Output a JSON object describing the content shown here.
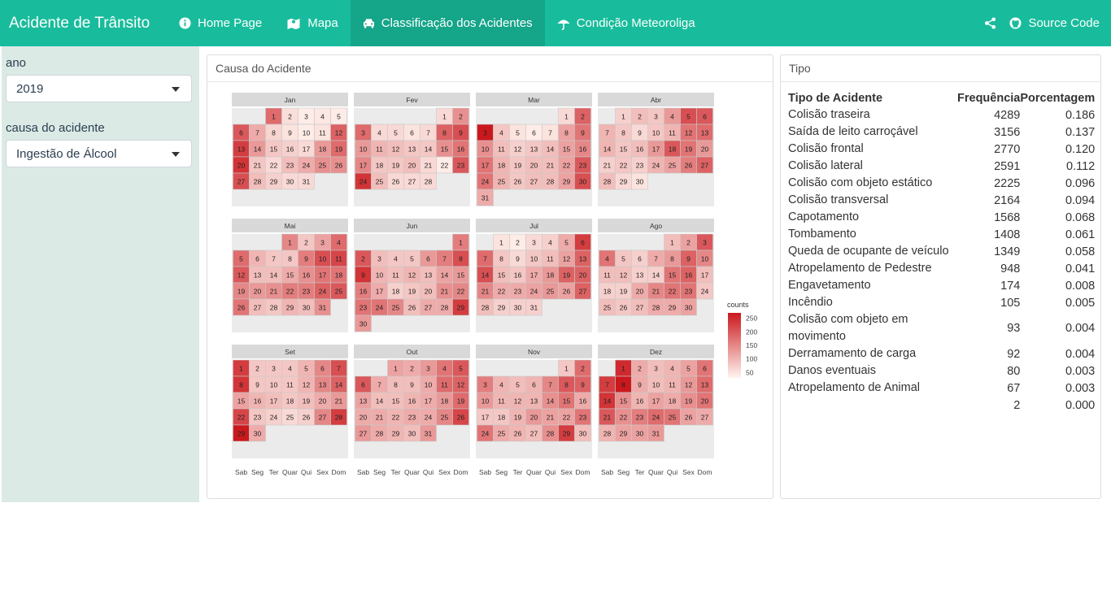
{
  "app": {
    "brand": "Acidente de Trânsito"
  },
  "nav": {
    "items": [
      {
        "label": "Home Page",
        "icon": "info-circle-icon",
        "active": false
      },
      {
        "label": "Mapa",
        "icon": "map-icon",
        "active": false
      },
      {
        "label": "Classificação dos Acidentes",
        "icon": "car-icon",
        "active": true
      },
      {
        "label": "Condição Meteoroliga",
        "icon": "umbrella-icon",
        "active": false
      }
    ],
    "share_icon": "share-icon",
    "source": {
      "label": "Source Code",
      "icon": "github-icon"
    }
  },
  "sidebar": {
    "ano_label": "ano",
    "ano_value": "2019",
    "causa_label": "causa do acidente",
    "causa_value": "Ingestão de Álcool"
  },
  "calendar_panel": {
    "title": "Causa do Acidente"
  },
  "tipo_panel": {
    "title": "Tipo",
    "headers": [
      "Tipo de Acidente",
      "Frequência",
      "Porcentagem"
    ],
    "rows": [
      [
        "Colisão traseira",
        "4289",
        "0.186"
      ],
      [
        "Saída de leito carroçável",
        "3156",
        "0.137"
      ],
      [
        "Colisão frontal",
        "2770",
        "0.120"
      ],
      [
        "Colisão lateral",
        "2591",
        "0.112"
      ],
      [
        "Colisão com objeto estático",
        "2225",
        "0.096"
      ],
      [
        "Colisão transversal",
        "2164",
        "0.094"
      ],
      [
        "Capotamento",
        "1568",
        "0.068"
      ],
      [
        "Tombamento",
        "1408",
        "0.061"
      ],
      [
        "Queda de ocupante de veículo",
        "1349",
        "0.058"
      ],
      [
        "Atropelamento de Pedestre",
        "948",
        "0.041"
      ],
      [
        "Engavetamento",
        "174",
        "0.008"
      ],
      [
        "Incêndio",
        "105",
        "0.005"
      ],
      [
        "Colisão com objeto em movimento",
        "93",
        "0.004"
      ],
      [
        "Derramamento de carga",
        "92",
        "0.004"
      ],
      [
        "Danos eventuais",
        "80",
        "0.003"
      ],
      [
        "Atropelamento de Animal",
        "67",
        "0.003"
      ],
      [
        "",
        "2",
        "0.000"
      ]
    ]
  },
  "colors": {
    "navbar": "#18bc9c",
    "navbar_active": "#15a589",
    "sidebar": "#dbeae5",
    "heat_high": "#cb181d",
    "heat_low": "#fff5f0"
  },
  "chart_data": {
    "type": "heatmap",
    "year": 2019,
    "weekdays": [
      "Sab",
      "Seg",
      "Ter",
      "Quar",
      "Qui",
      "Sex",
      "Dom"
    ],
    "legend": {
      "title": "counts",
      "ticks": [
        250,
        200,
        150,
        100,
        50
      ]
    },
    "months": [
      {
        "name": "Jan",
        "first_col": 2,
        "counts": [
          180,
          55,
          40,
          45,
          40,
          200,
          110,
          65,
          50,
          40,
          50,
          190,
          230,
          130,
          80,
          70,
          60,
          130,
          180,
          240,
          80,
          60,
          90,
          110,
          140,
          140,
          210,
          90,
          70,
          60,
          60
        ]
      },
      {
        "name": "Fev",
        "first_col": 5,
        "counts": [
          60,
          140,
          180,
          60,
          60,
          50,
          60,
          190,
          210,
          130,
          100,
          90,
          80,
          80,
          140,
          170,
          150,
          80,
          80,
          90,
          60,
          40,
          200,
          240,
          90,
          60,
          60,
          60
        ]
      },
      {
        "name": "Mar",
        "first_col": 5,
        "counts": [
          60,
          190,
          270,
          80,
          50,
          40,
          50,
          120,
          170,
          140,
          90,
          70,
          80,
          90,
          120,
          150,
          170,
          100,
          80,
          90,
          90,
          120,
          200,
          170,
          100,
          80,
          90,
          90,
          120,
          210,
          110
        ]
      },
      {
        "name": "Abr",
        "first_col": 1,
        "counts": [
          70,
          90,
          80,
          130,
          210,
          200,
          100,
          80,
          60,
          80,
          100,
          170,
          180,
          100,
          80,
          90,
          130,
          200,
          170,
          130,
          70,
          80,
          70,
          100,
          120,
          160,
          190,
          90,
          60,
          50
        ]
      },
      {
        "name": "Mai",
        "first_col": 3,
        "counts": [
          150,
          80,
          120,
          180,
          180,
          100,
          80,
          80,
          160,
          210,
          220,
          200,
          90,
          90,
          110,
          140,
          170,
          170,
          150,
          130,
          140,
          160,
          160,
          190,
          200,
          170,
          90,
          80,
          100,
          90,
          140
        ]
      },
      {
        "name": "Jun",
        "first_col": 6,
        "counts": [
          160,
          200,
          90,
          80,
          80,
          130,
          160,
          210,
          240,
          100,
          90,
          100,
          90,
          120,
          130,
          160,
          110,
          70,
          80,
          90,
          140,
          150,
          170,
          170,
          150,
          90,
          110,
          110,
          230,
          130
        ]
      },
      {
        "name": "Jul",
        "first_col": 1,
        "counts": [
          50,
          40,
          60,
          70,
          110,
          230,
          180,
          80,
          60,
          80,
          90,
          120,
          190,
          210,
          90,
          80,
          110,
          130,
          190,
          190,
          150,
          110,
          110,
          120,
          130,
          120,
          190,
          90,
          70,
          70,
          70
        ]
      },
      {
        "name": "Ago",
        "first_col": 4,
        "counts": [
          90,
          120,
          200,
          170,
          80,
          70,
          110,
          130,
          190,
          150,
          90,
          90,
          70,
          70,
          170,
          190,
          90,
          70,
          70,
          110,
          150,
          170,
          170,
          80,
          90,
          80,
          90,
          110,
          110,
          120
        ]
      },
      {
        "name": "Set",
        "first_col": 0,
        "counts": [
          230,
          80,
          80,
          80,
          100,
          150,
          210,
          240,
          80,
          80,
          80,
          100,
          150,
          190,
          120,
          100,
          90,
          80,
          90,
          110,
          130,
          220,
          80,
          70,
          60,
          70,
          150,
          230,
          270,
          110
        ]
      },
      {
        "name": "Out",
        "first_col": 2,
        "counts": [
          120,
          110,
          130,
          170,
          200,
          200,
          110,
          90,
          90,
          110,
          180,
          190,
          120,
          90,
          90,
          100,
          110,
          130,
          180,
          110,
          110,
          100,
          110,
          110,
          150,
          220,
          130,
          110,
          100,
          90,
          130
        ]
      },
      {
        "name": "Nov",
        "first_col": 5,
        "counts": [
          80,
          180,
          160,
          100,
          90,
          100,
          150,
          200,
          190,
          130,
          100,
          100,
          100,
          140,
          170,
          110,
          80,
          80,
          100,
          130,
          120,
          120,
          170,
          170,
          110,
          100,
          90,
          140,
          230,
          90
        ]
      },
      {
        "name": "Dez",
        "first_col": 1,
        "counts": [
          250,
          110,
          90,
          100,
          120,
          170,
          230,
          270,
          110,
          90,
          100,
          130,
          180,
          240,
          140,
          100,
          120,
          110,
          140,
          170,
          200,
          140,
          160,
          180,
          170,
          120,
          110,
          100,
          120,
          120,
          130
        ]
      }
    ]
  }
}
